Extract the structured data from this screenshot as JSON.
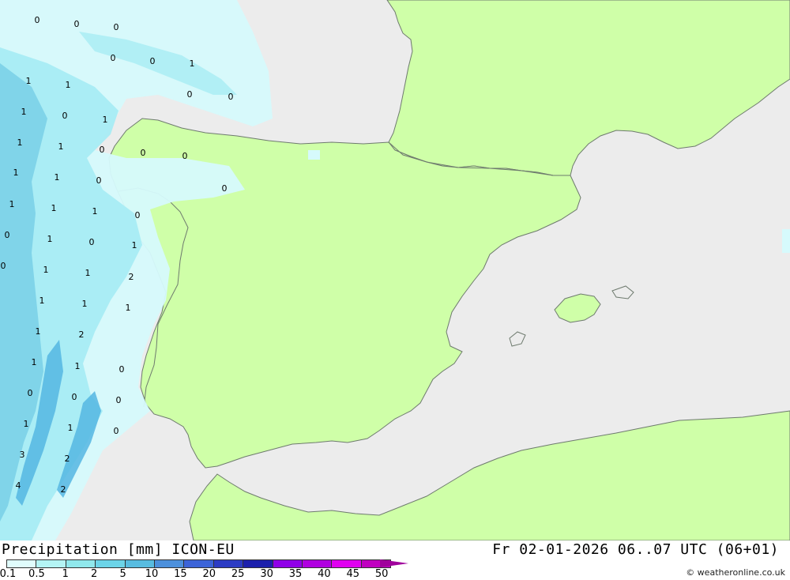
{
  "title": "Precipitation [mm] ICON-EU",
  "datetime": "Fr 02-01-2026 06..07 UTC (06+01)",
  "credit": "© weatheronline.co.uk",
  "colors": {
    "sea": "#ececec",
    "land": "#cfffa8",
    "border": "#6e7a6e",
    "precip_light": "#d6fafc",
    "precip_mid": "#a8ecf4",
    "precip_heavy": "#7bd0e8",
    "precip_heavier": "#55b6e2"
  },
  "legend": {
    "labels": [
      "0.1",
      "0.5",
      "1",
      "2",
      "5",
      "10",
      "15",
      "20",
      "25",
      "30",
      "35",
      "40",
      "45",
      "50"
    ],
    "colors": [
      "#e0fcfc",
      "#b4f4f4",
      "#90e8ec",
      "#6cd4e8",
      "#58bce0",
      "#4c90dc",
      "#3c64d8",
      "#2c3cc4",
      "#1c20ac",
      "#9000e8",
      "#b000e0",
      "#e000f0",
      "#c000c0",
      "#a0009c"
    ]
  },
  "values": [
    {
      "text": "0"
    },
    {
      "text": "0"
    },
    {
      "text": "0"
    },
    {
      "text": "0"
    },
    {
      "text": "0"
    },
    {
      "text": "1"
    },
    {
      "text": "0"
    },
    {
      "text": "0"
    },
    {
      "text": "1"
    },
    {
      "text": "1"
    },
    {
      "text": "1"
    },
    {
      "text": "0"
    },
    {
      "text": "1"
    },
    {
      "text": "1"
    },
    {
      "text": "1"
    },
    {
      "text": "0"
    },
    {
      "text": "0"
    },
    {
      "text": "0"
    },
    {
      "text": "1"
    },
    {
      "text": "1"
    },
    {
      "text": "0"
    },
    {
      "text": "0"
    },
    {
      "text": "1"
    },
    {
      "text": "1"
    },
    {
      "text": "1"
    },
    {
      "text": "0"
    },
    {
      "text": "0"
    },
    {
      "text": "1"
    },
    {
      "text": "0"
    },
    {
      "text": "1"
    },
    {
      "text": "0"
    },
    {
      "text": "1"
    },
    {
      "text": "1"
    },
    {
      "text": "2"
    },
    {
      "text": "1"
    },
    {
      "text": "1"
    },
    {
      "text": "1"
    },
    {
      "text": "1"
    },
    {
      "text": "2"
    },
    {
      "text": "1"
    },
    {
      "text": "1"
    },
    {
      "text": "0"
    },
    {
      "text": "0"
    },
    {
      "text": "0"
    },
    {
      "text": "0"
    },
    {
      "text": "1"
    },
    {
      "text": "1"
    },
    {
      "text": "0"
    },
    {
      "text": "3"
    },
    {
      "text": "2"
    },
    {
      "text": "4"
    },
    {
      "text": "2"
    }
  ]
}
